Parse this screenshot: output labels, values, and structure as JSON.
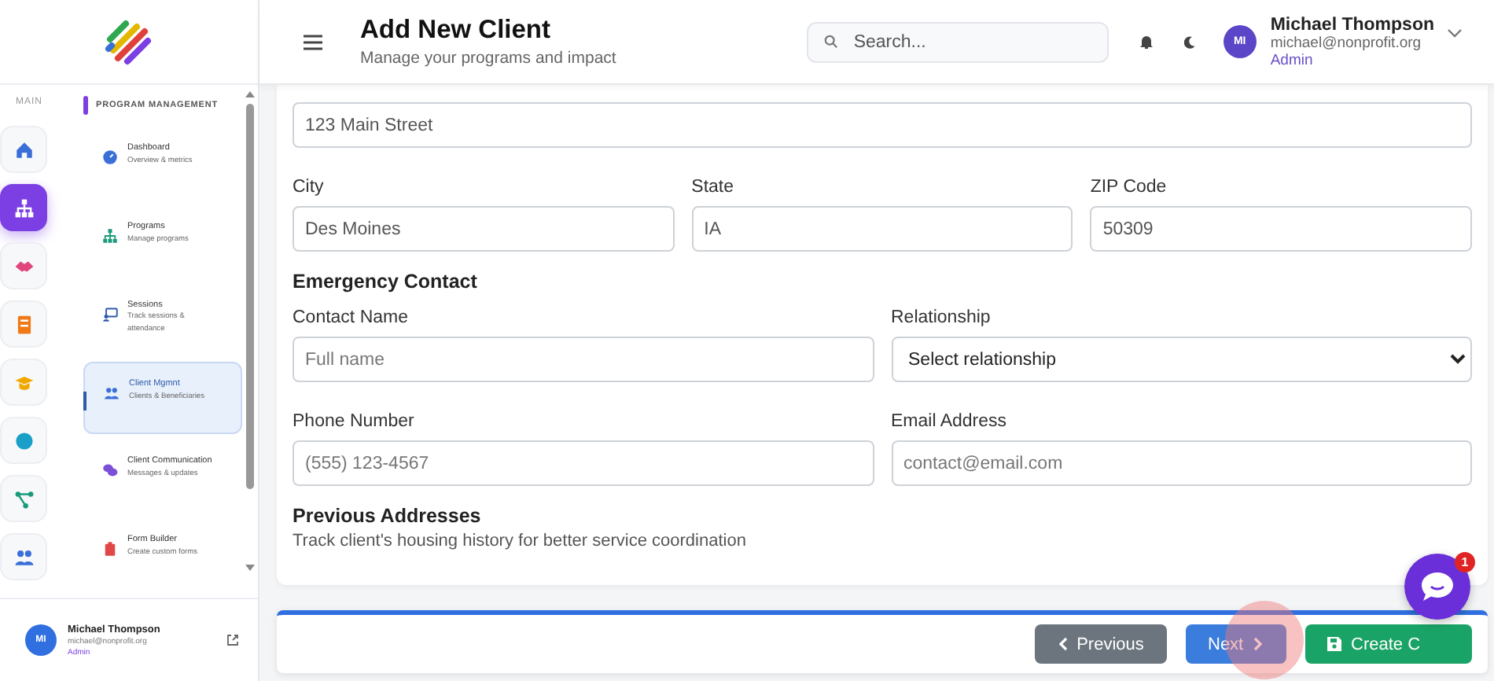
{
  "sidebar": {
    "rail_label": "MAIN",
    "rail_items": [
      {
        "color": "#3b6fd8",
        "selected": false
      },
      {
        "color": "#ffffff",
        "selected": true
      },
      {
        "color": "#e0457b",
        "selected": false
      },
      {
        "color": "#f07a1a",
        "selected": false
      },
      {
        "color": "#f0a800",
        "selected": false
      },
      {
        "color": "#1aa0c8",
        "selected": false
      },
      {
        "color": "#1a9a7a",
        "selected": false
      },
      {
        "color": "#3b6fd8",
        "selected": false
      }
    ],
    "section_title": "PROGRAM MANAGEMENT",
    "nav_items": [
      {
        "color": "#3b6fd8",
        "title": "Dashboard",
        "subtitle": "Overview & metrics",
        "selected": false
      },
      {
        "color": "#1a9a7a",
        "title": "Programs",
        "subtitle": "Manage programs",
        "selected": false
      },
      {
        "color": "#2c5aa8",
        "title": "Sessions",
        "subtitle": "Track sessions & attendance",
        "selected": false
      },
      {
        "color": "#3b6fd8",
        "title": "Client Mgmnt",
        "subtitle": "Clients & Beneficiaries",
        "selected": true
      },
      {
        "color": "#7b4fd8",
        "title": "Client Communication",
        "subtitle": "Messages & updates",
        "selected": false
      },
      {
        "color": "#e04848",
        "title": "Form Builder",
        "subtitle": "Create custom forms",
        "selected": false
      }
    ],
    "user": {
      "initials": "MI",
      "name": "Michael Thompson",
      "email": "michael@nonprofit.org",
      "role": "Admin"
    }
  },
  "header": {
    "title": "Add New Client",
    "subtitle": "Manage your programs and impact",
    "search": {
      "placeholder": "Search..."
    },
    "user": {
      "initials": "MI",
      "name": "Michael Thompson",
      "email": "michael@nonprofit.org",
      "role": "Admin"
    }
  },
  "form": {
    "sections": [
      {
        "rows": [
          [
            {
              "kind": "text",
              "value": "123 Main Street"
            }
          ],
          [
            {
              "kind": "text",
              "label": "City",
              "value": "Des Moines"
            },
            {
              "kind": "text",
              "label": "State",
              "value": "IA"
            },
            {
              "kind": "text",
              "label": "ZIP Code",
              "value": "50309"
            }
          ]
        ]
      },
      {
        "heading": "Emergency Contact",
        "rows": [
          [
            {
              "kind": "text",
              "label": "Contact Name",
              "placeholder": "Full name"
            },
            {
              "kind": "select",
              "label": "Relationship",
              "value": "Select relationship"
            }
          ],
          [
            {
              "kind": "text",
              "label": "Phone Number",
              "placeholder": "(555) 123-4567"
            },
            {
              "kind": "text",
              "label": "Email Address",
              "placeholder": "contact@email.com"
            }
          ]
        ]
      },
      {
        "heading": "Previous Addresses",
        "description": "Track client's housing history for better service coordination"
      }
    ]
  },
  "footer": {
    "buttons": [
      {
        "kind": "previous",
        "label": "Previous"
      },
      {
        "kind": "next",
        "label": "Next"
      },
      {
        "kind": "create",
        "label": "Create C"
      }
    ]
  },
  "chat": {
    "badge": "1"
  }
}
